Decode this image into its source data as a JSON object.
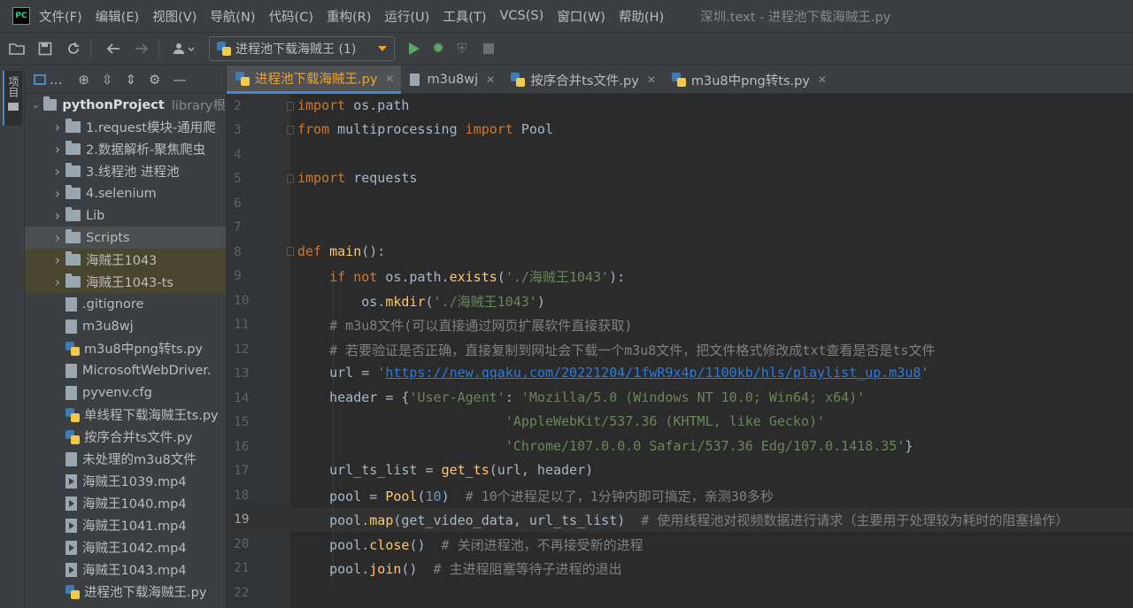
{
  "menu": {
    "logo": "PC",
    "items": [
      "文件(F)",
      "编辑(E)",
      "视图(V)",
      "导航(N)",
      "代码(C)",
      "重构(R)",
      "运行(U)",
      "工具(T)",
      "VCS(S)",
      "窗口(W)",
      "帮助(H)"
    ],
    "window_title": "深圳.text - 进程池下载海贼王.py"
  },
  "toolbar": {
    "run_config": "进程池下载海贼王 (1)"
  },
  "left_strip": {
    "label": "项目"
  },
  "project": {
    "header_label": "...",
    "root": {
      "name": "pythonProject",
      "sub": "library根"
    },
    "items": [
      {
        "type": "folder",
        "label": "1.request模块-通用爬"
      },
      {
        "type": "folder",
        "label": "2.数据解析-聚焦爬虫"
      },
      {
        "type": "folder",
        "label": "3.线程池 进程池"
      },
      {
        "type": "folder",
        "label": "4.selenium"
      },
      {
        "type": "folder",
        "label": "Lib"
      },
      {
        "type": "folder",
        "label": "Scripts"
      },
      {
        "type": "folder",
        "label": "海贼王1043"
      },
      {
        "type": "folder",
        "label": "海贼王1043-ts"
      },
      {
        "type": "file",
        "label": ".gitignore"
      },
      {
        "type": "file",
        "label": "m3u8wj"
      },
      {
        "type": "py",
        "label": "m3u8中png转ts.py"
      },
      {
        "type": "file",
        "label": "MicrosoftWebDriver."
      },
      {
        "type": "file",
        "label": "pyvenv.cfg"
      },
      {
        "type": "py",
        "label": "单线程下载海贼王ts.py"
      },
      {
        "type": "py",
        "label": "按序合并ts文件.py"
      },
      {
        "type": "file",
        "label": "未处理的m3u8文件"
      },
      {
        "type": "mp4",
        "label": "海贼王1039.mp4"
      },
      {
        "type": "mp4",
        "label": "海贼王1040.mp4"
      },
      {
        "type": "mp4",
        "label": "海贼王1041.mp4"
      },
      {
        "type": "mp4",
        "label": "海贼王1042.mp4"
      },
      {
        "type": "mp4",
        "label": "海贼王1043.mp4"
      },
      {
        "type": "py",
        "label": "进程池下载海贼王.py"
      }
    ]
  },
  "tabs": [
    {
      "label": "进程池下载海贼王.py",
      "active": true,
      "icon": "python-file-icon"
    },
    {
      "label": "m3u8wj",
      "active": false,
      "icon": "text-file-icon"
    },
    {
      "label": "按序合并ts文件.py",
      "active": false,
      "icon": "python-file-icon"
    },
    {
      "label": "m3u8中png转ts.py",
      "active": false,
      "icon": "python-file-icon"
    }
  ],
  "editor": {
    "current_line": "19",
    "line_numbers": [
      "2",
      "3",
      "4",
      "5",
      "6",
      "7",
      "8",
      "9",
      "10",
      "11",
      "12",
      "13",
      "14",
      "15",
      "16",
      "17",
      "18",
      "19",
      "20",
      "21",
      "22"
    ],
    "code": {
      "l2_a": "import",
      "l2_b": " os.path",
      "l3_a": "from",
      "l3_b": " multiprocessing ",
      "l3_c": "import",
      "l3_d": " Pool",
      "l5_a": "import",
      "l5_b": " requests",
      "l8_a": "def",
      "l8_b": "main",
      "l8_c": "():",
      "l9_a": "if not",
      "l9_b": " os.path.",
      "l9_c": "exists",
      "l9_d": "(",
      "l9_e": "'./海贼王1043'",
      "l9_f": "):",
      "l10_a": "os.",
      "l10_b": "mkdir",
      "l10_c": "(",
      "l10_d": "'./海贼王1043'",
      "l10_e": ")",
      "l11": "# m3u8文件(可以直接通过网页扩展软件直接获取)",
      "l12": "# 若要验证是否正确，直接复制到网址会下载一个m3u8文件，把文件格式修改成txt查看是否是ts文件",
      "l13_a": "url = ",
      "l13_b": "'",
      "l13_c": "https://new.qqaku.com/20221204/1fwR9x4p/1100kb/hls/playlist_up.m3u8",
      "l13_d": "'",
      "l14_a": "header = {",
      "l14_b": "'User-Agent'",
      "l14_c": ": ",
      "l14_d": "'Mozilla/5.0 (Windows NT 10.0; Win64; x64)'",
      "l15": "'AppleWebKit/537.36 (KHTML, like Gecko)'",
      "l16_a": "'Chrome/107.0.0.0 Safari/537.36 Edg/107.0.1418.35'",
      "l16_b": "}",
      "l17_a": "url_ts_list = ",
      "l17_b": "get_ts",
      "l17_c": "(url, header)",
      "l18_a": "pool = ",
      "l18_b": "Pool",
      "l18_c": "(",
      "l18_d": "10",
      "l18_e": ")",
      "l18_f": "  # 10个进程足以了，1分钟内即可搞定，亲测30多秒",
      "l19_a": "pool.",
      "l19_b": "map",
      "l19_c": "(get_video_data, url_ts_list)",
      "l19_d": "  # 使用线程池对视频数据进行请求（主要用于处理较为耗时的阻塞操作）",
      "l20_a": "pool.",
      "l20_b": "close",
      "l20_c": "()",
      "l20_d": "  # 关闭进程池，不再接受新的进程",
      "l21_a": "pool.",
      "l21_b": "join",
      "l21_c": "()",
      "l21_d": "  # 主进程阻塞等待子进程的退出"
    }
  },
  "colors": {
    "keyword": "#cc7832",
    "function": "#ffc66d",
    "string": "#6a8759",
    "number": "#6897bb",
    "comment": "#808080",
    "url": "#287bde",
    "active_tab_text": "#e8a33a",
    "accent": "#4a88c7"
  }
}
